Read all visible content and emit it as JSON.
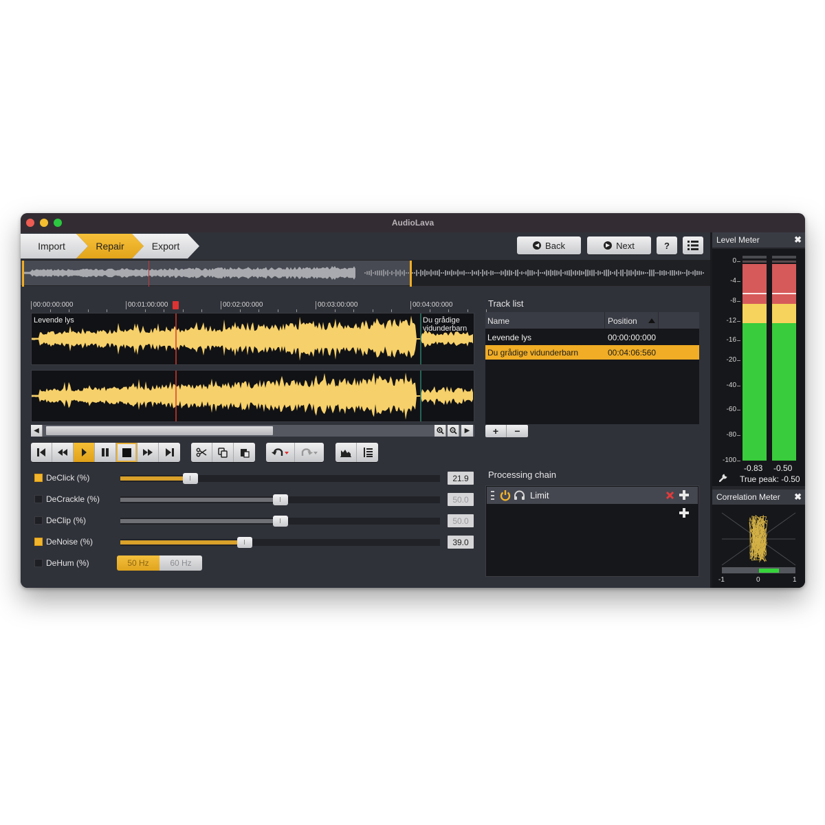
{
  "window": {
    "title": "AudioLava"
  },
  "steps": [
    {
      "label": "Import",
      "active": false
    },
    {
      "label": "Repair",
      "active": true
    },
    {
      "label": "Export",
      "active": false
    }
  ],
  "top_buttons": {
    "back": "Back",
    "next": "Next",
    "help": "?"
  },
  "timeline": {
    "ticks": [
      "00:00:00:000",
      "00:01:00:000",
      "00:02:00:000",
      "00:03:00:000",
      "00:04:00:000"
    ],
    "tracks": [
      "Levende lys",
      "Du grådige vidunderbarn"
    ],
    "track2_label_lines": [
      "Du grådige",
      "vidunderbarn"
    ]
  },
  "track_list": {
    "title": "Track list",
    "columns": [
      "Name",
      "Position"
    ],
    "rows": [
      {
        "name": "Levende lys",
        "position": "00:00:00:000",
        "selected": false
      },
      {
        "name": "Du grådige vidunderbarn",
        "position": "00:04:06:560",
        "selected": true
      }
    ],
    "add_label": "+",
    "remove_label": "−"
  },
  "filters": [
    {
      "label": "DeClick (%)",
      "enabled": true,
      "value": "21.9",
      "percent": 21.9
    },
    {
      "label": "DeCrackle (%)",
      "enabled": false,
      "value": "50.0",
      "percent": 50.0
    },
    {
      "label": "DeClip (%)",
      "enabled": false,
      "value": "50.0",
      "percent": 50.0
    },
    {
      "label": "DeNoise (%)",
      "enabled": true,
      "value": "39.0",
      "percent": 39.0
    },
    {
      "label": "DeHum (%)",
      "enabled": false,
      "options": [
        "50 Hz",
        "60 Hz"
      ],
      "selected": "50 Hz"
    }
  ],
  "processing_chain": {
    "title": "Processing chain",
    "items": [
      {
        "name": "Limit",
        "power": true
      }
    ]
  },
  "level_meter": {
    "title": "Level Meter",
    "scale": [
      "0",
      "-4",
      "-8",
      "-12",
      "-16",
      "-20",
      "-40",
      "-60",
      "-80",
      "-100"
    ],
    "channels": [
      {
        "peak": "-0.83"
      },
      {
        "peak": "-0.50"
      }
    ],
    "true_peak": "True peak: -0.50",
    "colors": {
      "red": "#d65a5a",
      "yellow": "#f6d35c",
      "green": "#39cc3c"
    }
  },
  "correlation_meter": {
    "title": "Correlation Meter",
    "labels": [
      "-1",
      "0",
      "1"
    ],
    "range": [
      0.0,
      0.55
    ]
  },
  "colors": {
    "accent": "#f0ad25",
    "waveform": "#f6d06a",
    "playhead": "#d83a2f"
  }
}
